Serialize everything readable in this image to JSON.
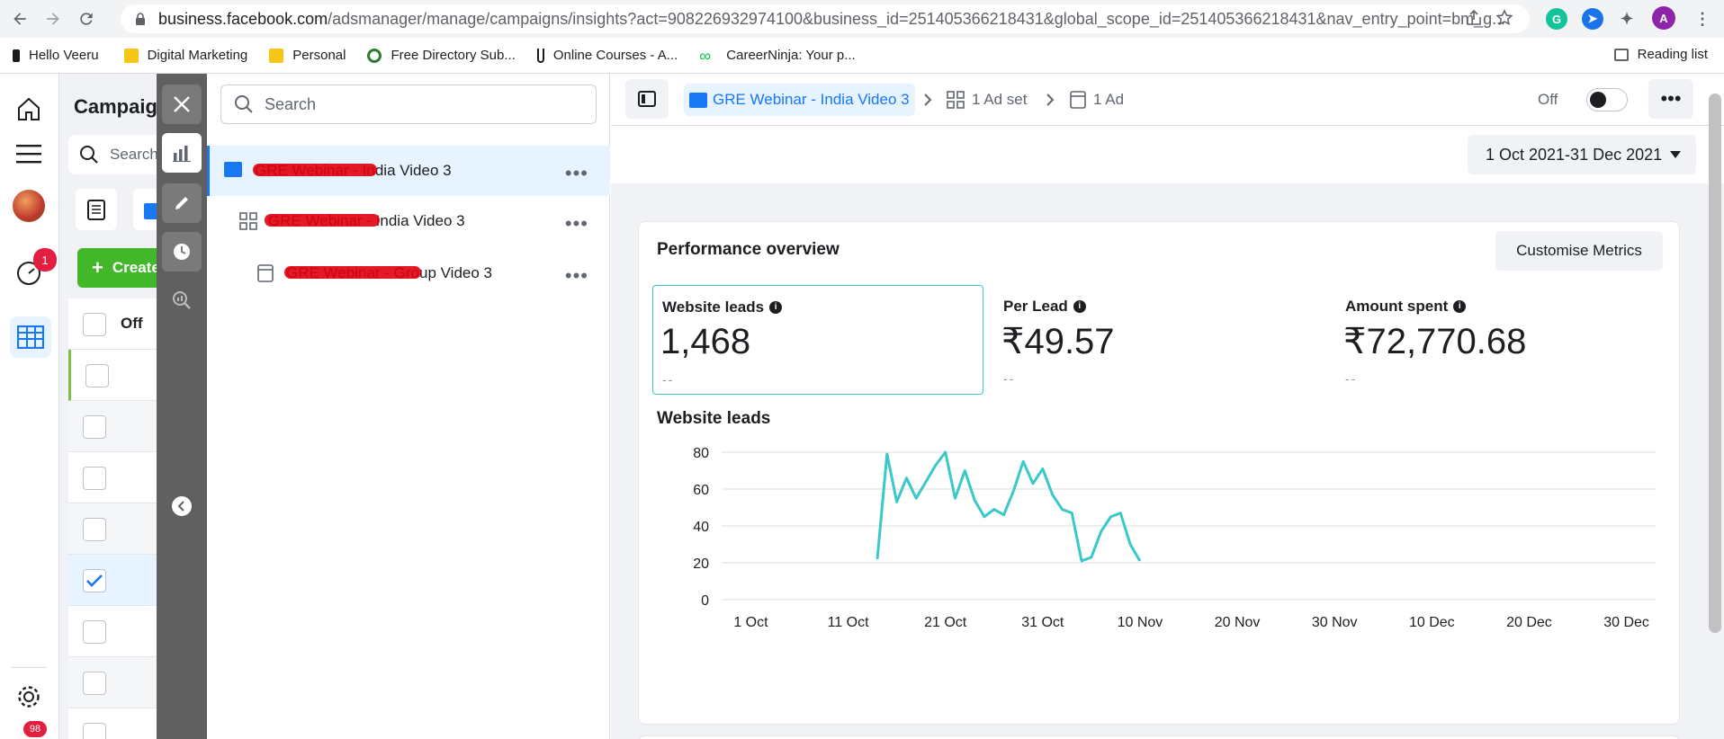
{
  "browser": {
    "url_host": "business.facebook.com",
    "url_rest": "/adsmanager/manage/campaigns/insights?act=908226932974100&business_id=251405366218431&global_scope_id=251405366218431&nav_entry_point=bm_g...",
    "profile_initial": "A",
    "bookmarks": [
      {
        "label": "Hello Veeru",
        "color": "#1a1a1a"
      },
      {
        "label": "Digital Marketing",
        "color": "#f5c518"
      },
      {
        "label": "Personal",
        "color": "#f5c518"
      },
      {
        "label": "Free Directory Sub...",
        "color": "#2e7d32"
      },
      {
        "label": "Online Courses - A...",
        "color": "#1a1a1a"
      },
      {
        "label": "CareerNinja: Your p...",
        "color": "#00c853"
      }
    ],
    "reading_list": "Reading list"
  },
  "fbnav": {
    "notifications_badge": "1",
    "bottom_badge": "98"
  },
  "background": {
    "title": "Campaigns",
    "search_placeholder": "Search",
    "create_label": "Create",
    "off_header": "Off"
  },
  "tree": {
    "search_placeholder": "Search",
    "items": [
      {
        "label": "GRE Webinar - India Video 3"
      },
      {
        "label": "GRE Webinar - India Video 3"
      },
      {
        "label": "GRE Webinar - Group Video 3"
      }
    ]
  },
  "header": {
    "campaign_crumb": "GRE Webinar - India Video 3",
    "adset_crumb": "1 Ad set",
    "ad_crumb": "1 Ad",
    "status_label": "Off",
    "more_glyph": "•••"
  },
  "date_range": "1 Oct 2021-31 Dec 2021",
  "performance": {
    "title": "Performance overview",
    "customise_label": "Customise Metrics",
    "metrics": [
      {
        "label": "Website leads",
        "value": "1,468",
        "comparison": "--"
      },
      {
        "label": "Per Lead",
        "value": "₹49.57",
        "comparison": "--"
      },
      {
        "label": "Amount spent",
        "value": "₹72,770.68",
        "comparison": "--"
      }
    ],
    "chart_title": "Website leads"
  },
  "chart_data": {
    "type": "line",
    "x_ticks": [
      "1 Oct",
      "11 Oct",
      "21 Oct",
      "31 Oct",
      "10 Nov",
      "20 Nov",
      "30 Nov",
      "10 Dec",
      "20 Dec",
      "30 Dec"
    ],
    "y_ticks": [
      0,
      20,
      40,
      60,
      80
    ],
    "ylim": [
      0,
      80
    ],
    "xlim_days": [
      -3,
      93
    ],
    "grid": true,
    "series": [
      {
        "color": "#3ac8c8",
        "x": [
          10,
          11,
          12,
          13,
          14,
          15,
          16,
          17,
          18,
          19,
          20,
          21,
          22,
          23,
          24,
          25,
          26,
          27,
          28,
          29,
          30,
          31,
          32,
          33,
          34,
          35,
          36,
          37,
          38
        ],
        "values": [
          22,
          79,
          53,
          66,
          55,
          64,
          73,
          80,
          55,
          70,
          54,
          45,
          49,
          46,
          59,
          75,
          63,
          71,
          57,
          49,
          47,
          21,
          23,
          37,
          45,
          47,
          30,
          21,
          null
        ]
      }
    ]
  }
}
